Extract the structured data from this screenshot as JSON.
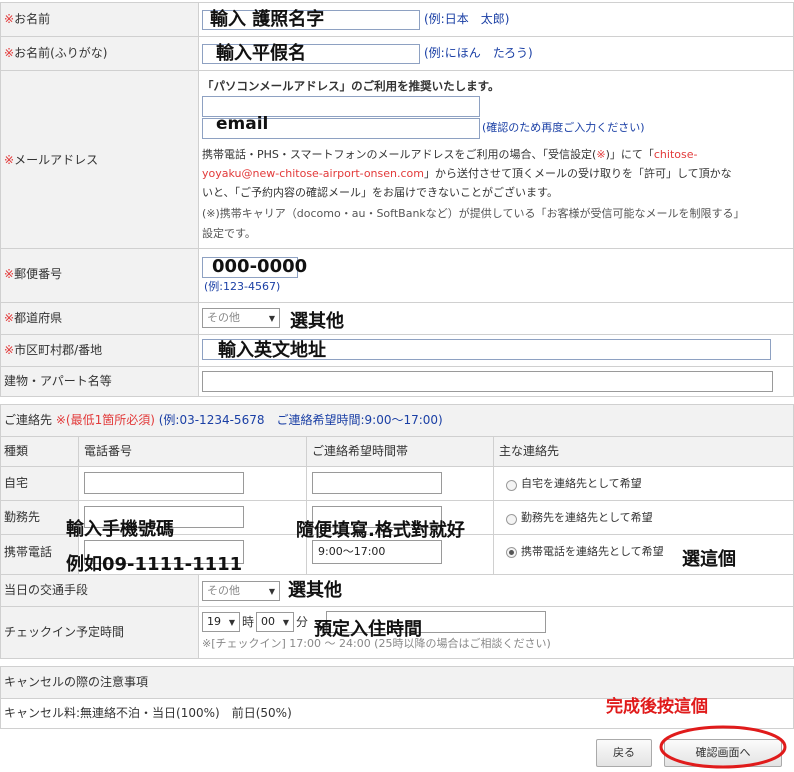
{
  "form": {
    "name": {
      "label": "お名前",
      "required_mark": "※",
      "value": "輸入 護照名字",
      "example": "(例:日本　太郎)"
    },
    "kana": {
      "label": "お名前(ふりがな)",
      "required_mark": "※",
      "value": "輸入平假名",
      "example": "(例:にほん　たろう)"
    },
    "email": {
      "label": "メールアドレス",
      "required_mark": "※",
      "recommend": "「パソコンメールアドレス」のご利用を推奨いたします。",
      "value2": "email",
      "confirm_note": "(確認のため再度ご入力ください)",
      "notice_prefix": "携帯電話・PHS・スマートフォンのメールアドレスをご利用の場合、「受信設定(",
      "notice_mark": "※",
      "notice_mid": ")」にて「",
      "notice_domain_a": "chitose-",
      "notice_domain_b": "yoyaku@new-chitose-airport-onsen.com",
      "notice_rest_a": "」から送付させて頂くメールの受け取りを「許可」して頂かな",
      "notice_rest_b": "いと、「ご予約内容の確認メール」をお届けできないことがございます。",
      "carrier_note_a": "(※)携帯キャリア（docomo・au・SoftBankなど）が提供している「お客様が受信可能なメールを制限する」",
      "carrier_note_b": "設定です。"
    },
    "postal": {
      "label": "郵便番号",
      "required_mark": "※",
      "value": "000-0000",
      "example": "(例:123-4567)"
    },
    "prefecture": {
      "label": "都道府県",
      "required_mark": "※",
      "selected": "その他",
      "note": "選其他"
    },
    "city": {
      "label": "市区町村郡/番地",
      "required_mark": "※",
      "value": "輸入英文地址"
    },
    "building": {
      "label": "建物・アパート名等"
    },
    "contact": {
      "header_label": "ご連絡先",
      "header_req": "※(最低1箇所必須)",
      "header_example": "(例:03-1234-5678　ご連絡希望時間:9:00～17:00)",
      "columns": [
        "種類",
        "電話番号",
        "ご連絡希望時間帯",
        "主な連絡先"
      ],
      "rows": [
        {
          "type": "自宅",
          "phone": "",
          "time": "",
          "radio_label": "自宅を連絡先として希望",
          "selected": false
        },
        {
          "type": "勤務先",
          "phone": "",
          "time": "",
          "radio_label": "勤務先を連絡先として希望",
          "selected": false
        },
        {
          "type": "携帯電話",
          "phone": "",
          "time": "9:00～17:00",
          "radio_label": "携帯電話を連絡先として希望",
          "selected": true
        }
      ],
      "phone_note_1": "輸入手機號碼",
      "phone_note_2": "例如09-1111-1111",
      "time_note": "隨便填寫.格式對就好",
      "radio_note": "選這個"
    },
    "transport": {
      "label": "当日の交通手段",
      "selected": "その他",
      "note": "選其他"
    },
    "checkin": {
      "label": "チェックイン予定時間",
      "hour": "19",
      "hour_unit": "時",
      "minute": "00",
      "minute_unit": "分",
      "note": "預定入住時間",
      "hint": "※[チェックイン] 17:00 ～ 24:00 (25時以降の場合はご相談ください)"
    },
    "cancel": {
      "title": "キャンセルの際の注意事項",
      "policy": "キャンセル料:無連絡不泊・当日(100%)　前日(50%)"
    },
    "buttons": {
      "back": "戻る",
      "confirm": "確認画面へ",
      "done_note": "完成後按這個"
    }
  },
  "colors": {
    "required": "#e23a3a",
    "example": "#1a3fa5",
    "annotation_red": "#e01b1b",
    "label_bg": "#f2f2f2"
  }
}
